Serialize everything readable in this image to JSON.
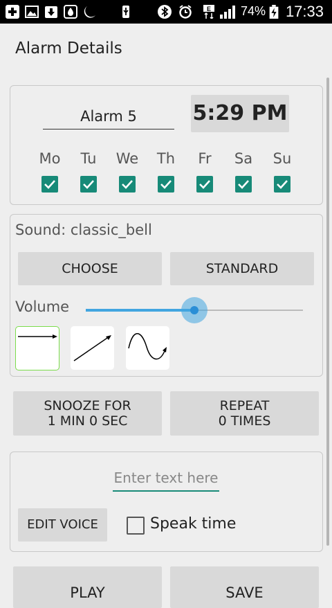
{
  "statusbar": {
    "icons": [
      "plus-icon",
      "image-icon",
      "download-icon",
      "water-drop-icon",
      "sleep-moon-icon",
      "usb-icon",
      "bluetooth-icon",
      "alarm-clock-icon",
      "network-e-icon",
      "signal-bars-icon",
      "battery-charging-icon"
    ],
    "battery": "74%",
    "time": "17:33"
  },
  "header": {
    "title": "Alarm Details"
  },
  "alarm": {
    "name": "Alarm 5",
    "time": "5:29 PM",
    "days": [
      {
        "label": "Mo",
        "checked": true
      },
      {
        "label": "Tu",
        "checked": true
      },
      {
        "label": "We",
        "checked": true
      },
      {
        "label": "Th",
        "checked": true
      },
      {
        "label": "Fr",
        "checked": true
      },
      {
        "label": "Sa",
        "checked": true
      },
      {
        "label": "Su",
        "checked": true
      }
    ]
  },
  "sound": {
    "label": "Sound: classic_bell",
    "choose_label": "CHOOSE",
    "standard_label": "STANDARD",
    "volume_label": "Volume",
    "volume_level": 0.5,
    "accent": "#42a5e0",
    "curves": [
      "constant-curve-icon",
      "linear-increase-curve-icon",
      "wave-curve-icon"
    ],
    "selected_curve": 0
  },
  "snooze": {
    "line1": "SNOOZE FOR",
    "line2": "1 MIN 0 SEC"
  },
  "repeat": {
    "line1": "REPEAT",
    "line2": "0 TIMES"
  },
  "voice": {
    "placeholder": "Enter text here",
    "edit_label": "EDIT VOICE",
    "speak_time_label": "Speak time",
    "speak_time_checked": false
  },
  "footer": {
    "play_label": "PLAY",
    "save_label": "SAVE"
  },
  "colors": {
    "check_accent": "#178a78",
    "statusbar_bg": "#000000",
    "page_bg": "#eeeeee"
  }
}
